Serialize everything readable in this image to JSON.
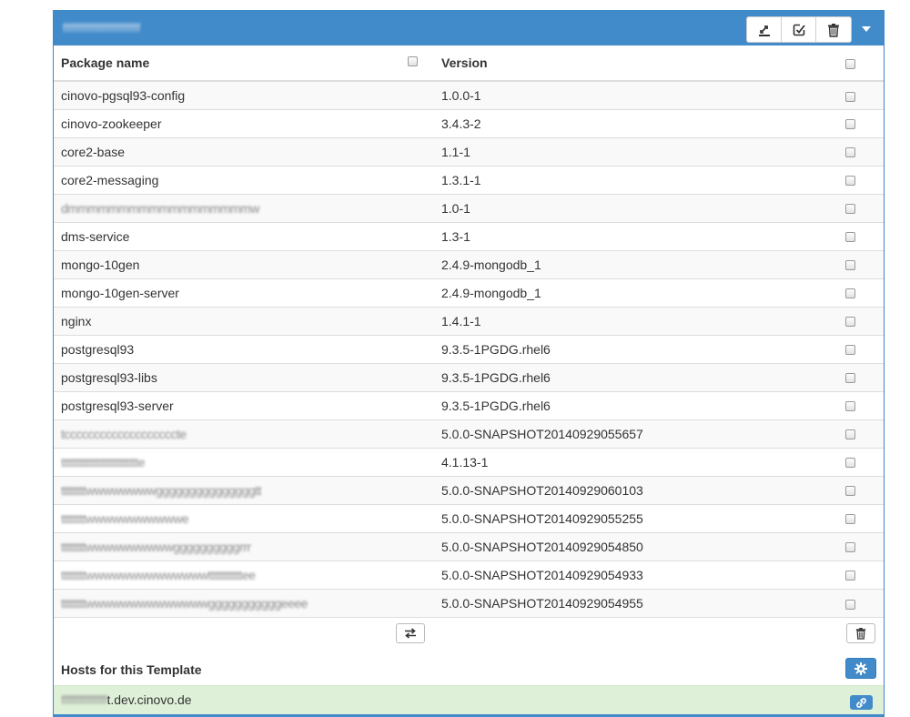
{
  "panel": {
    "title": "ffffffffffffffffffffff",
    "toolbar": [
      {
        "icon": "deploy-icon"
      },
      {
        "icon": "edit-check-icon"
      },
      {
        "icon": "trash-icon"
      }
    ],
    "dropdown_icon": "caret-down-icon"
  },
  "table": {
    "headers": {
      "package": "Package name",
      "version": "Version"
    },
    "rows": [
      {
        "name": "cinovo-pgsql93-config",
        "version": "1.0.0-1",
        "blurred": false
      },
      {
        "name": "cinovo-zookeeper",
        "version": "3.4.3-2",
        "blurred": false
      },
      {
        "name": "core2-base",
        "version": "1.1-1",
        "blurred": false
      },
      {
        "name": "core2-messaging",
        "version": "1.3.1-1",
        "blurred": false
      },
      {
        "name": "dmmmmmmmmmmmmmmmmmmw",
        "version": "1.0-1",
        "blurred": true
      },
      {
        "name": "dms-service",
        "version": "1.3-1",
        "blurred": false
      },
      {
        "name": "mongo-10gen",
        "version": "2.4.9-mongodb_1",
        "blurred": false
      },
      {
        "name": "mongo-10gen-server",
        "version": "2.4.9-mongodb_1",
        "blurred": false
      },
      {
        "name": "nginx",
        "version": "1.4.1-1",
        "blurred": false
      },
      {
        "name": "postgresql93",
        "version": "9.3.5-1PGDG.rhel6",
        "blurred": false
      },
      {
        "name": "postgresql93-libs",
        "version": "9.3.5-1PGDG.rhel6",
        "blurred": false
      },
      {
        "name": "postgresql93-server",
        "version": "9.3.5-1PGDG.rhel6",
        "blurred": false
      },
      {
        "name": "tcccccccccccccccccccte",
        "version": "5.0.0-SNAPSHOT20140929055657",
        "blurred": true
      },
      {
        "name": "ttttttttttttttttttttttttte",
        "version": "4.1.13-1",
        "blurred": true
      },
      {
        "name": "ttttttttwwwwwwwwgggggggggggggggtt",
        "version": "5.0.0-SNAPSHOT20140929060103",
        "blurred": true
      },
      {
        "name": "ttttttttwwwwwwwwwwwe",
        "version": "5.0.0-SNAPSHOT20140929055255",
        "blurred": true
      },
      {
        "name": "ttttttttwwwwwwwwwwggggggggggrrr",
        "version": "5.0.0-SNAPSHOT20140929054850",
        "blurred": true
      },
      {
        "name": "ttttttttwwwwwwwwwwwwwwtttttttttttee",
        "version": "5.0.0-SNAPSHOT20140929054933",
        "blurred": true
      },
      {
        "name": "ttttttttwwwwwwwwwwwwwwgggggggggggeeee",
        "version": "5.0.0-SNAPSHOT20140929054955",
        "blurred": true
      }
    ]
  },
  "actions": {
    "swap_icon": "swap-arrows-icon",
    "delete_icon": "trash-icon"
  },
  "hosts": {
    "title": "Hosts for this Template",
    "settings_icon": "gear-icon",
    "items": [
      {
        "prefix": "ffffffffffffffff",
        "domain": "t.dev.cinovo.de",
        "link_icon": "link-icon"
      }
    ]
  },
  "colors": {
    "primary": "#428bca",
    "success_row": "#dff0d8",
    "stripe": "#f9f9f9",
    "border": "#dddddd"
  }
}
